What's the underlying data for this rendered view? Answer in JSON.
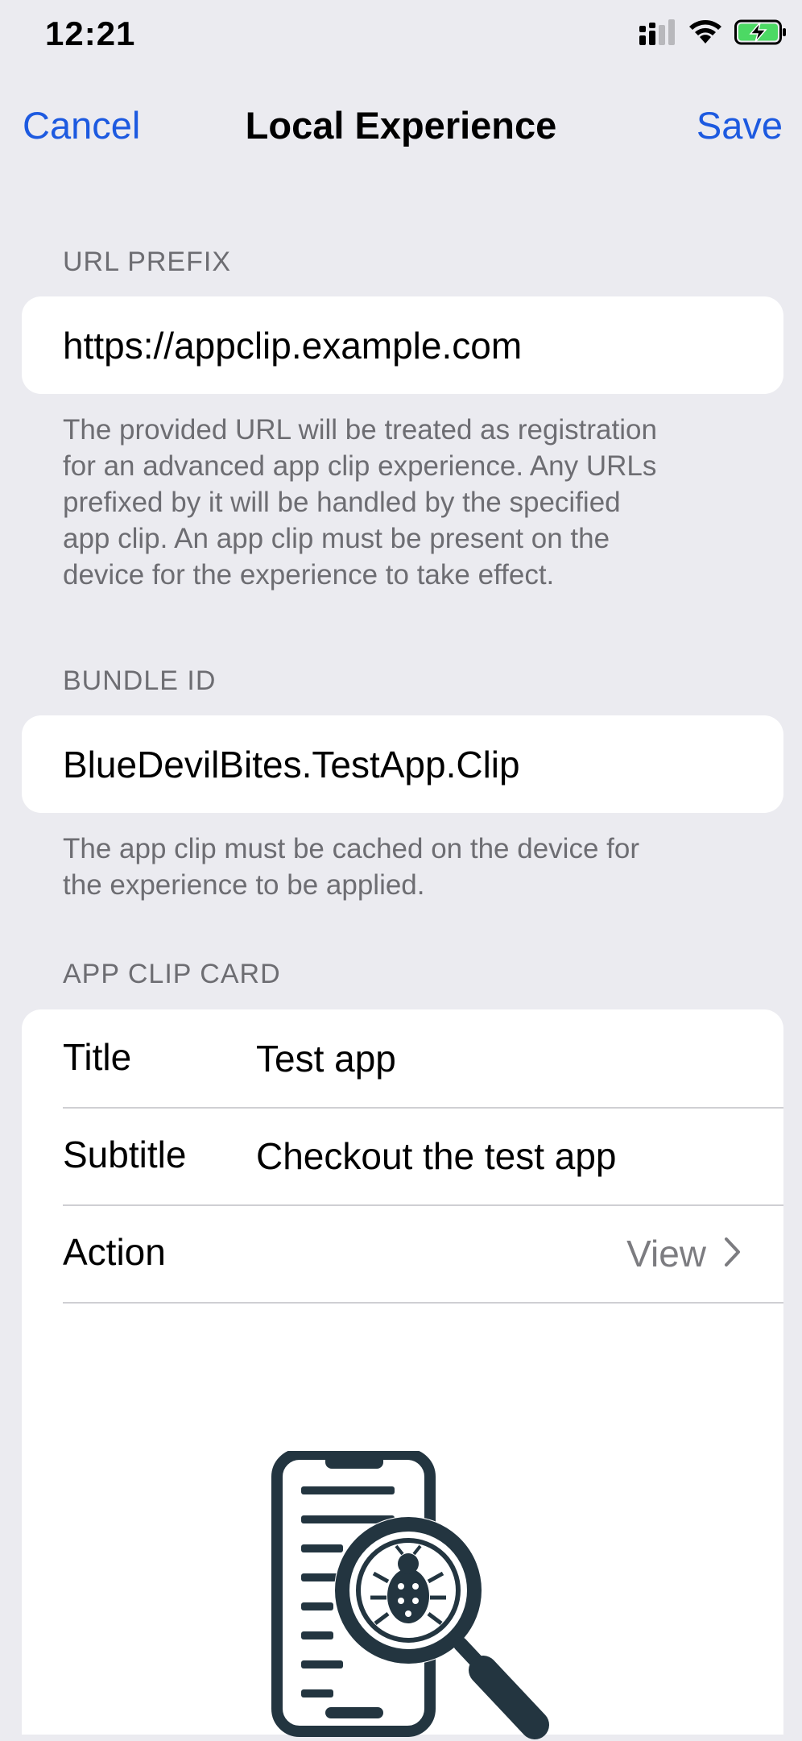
{
  "status_bar": {
    "time": "12:21",
    "icons": [
      "signal-icon",
      "wifi-icon",
      "battery-charging-icon"
    ]
  },
  "nav": {
    "cancel_label": "Cancel",
    "title": "Local Experience",
    "save_label": "Save"
  },
  "url_section": {
    "header": "URL PREFIX",
    "value": "https://appclip.example.com",
    "footer_lines": [
      "The provided URL will be treated as registration",
      "for an advanced app clip experience. Any URLs",
      "prefixed by it will be handled by the specified",
      "app clip. An app clip must be present on the",
      "device for the experience to take effect."
    ]
  },
  "bundle_section": {
    "header": "BUNDLE ID",
    "value": "BlueDevilBites.TestApp.Clip",
    "footer_lines": [
      "The app clip must be cached on the device for",
      "the experience to be applied."
    ]
  },
  "card_section": {
    "header": "APP CLIP CARD",
    "title_label": "Title",
    "title_value": "Test app",
    "subtitle_label": "Subtitle",
    "subtitle_value": "Checkout the test app",
    "action_label": "Action",
    "action_value": "View",
    "image_icon": "phone-bug-search-icon"
  },
  "colors": {
    "accent": "#1d5ae0",
    "background": "#ebebf0",
    "secondary_text": "#6d6d72",
    "icon_dark": "#233540"
  }
}
